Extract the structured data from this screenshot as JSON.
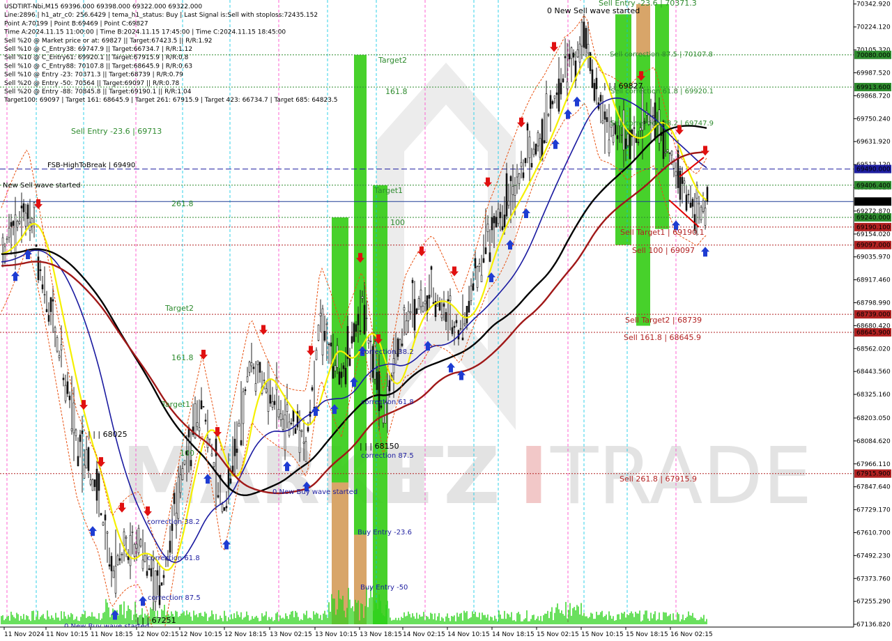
{
  "chart_data": {
    "type": "candlestick",
    "symbol": "USDTIRT-Nbi,M15",
    "info_lines": [
      "USDTIRT-Nbi,M15  69396.000 69398.000 69322.000 69322.000",
      "Line:2896 | h1_atr_c0: 256.6429 | tema_h1_status: Buy | Last Signal is:Sell with stoploss:72435.152",
      "Point A:70199 | Point B:69469 | Point C:69827",
      "Time A:2024.11.15 11:00:00 | Time B:2024.11.15 17:45:00 | Time C:2024.11.15 18:45:00",
      "Sell %20 @ Market price or at: 69827 || Target:67423.5 || R/R:1.92",
      "Sell %10 @ C_Entry38: 69747.9 || Target:66734.7 | R/R:1.12",
      "Sell %10 @ C_Entry61: 69920.1 || Target:67915.9 | R/R:0.8",
      "Sell %10 @ C_Entry88: 70107.8 || Target:68645.9 | R/R:0.63",
      "Sell %10 @ Entry -23: 70371.3 || Target:68739 | R/R:0.79",
      "Sell %20 @ Entry -50: 70564 || Target:69097 || R/R:0.78",
      "Sell %20 @ Entry -88: 70845.8 || Target:69190.1 || R/R:1.04",
      "Target100: 69097 | Target 161: 68645.9 | Target 261: 67915.9 | Target 423: 66734.7 | Target 685: 64823.5"
    ],
    "y_range": [
      67137,
      70342
    ],
    "y_ticks": [
      "70342.920",
      "70224.120",
      "70105.320",
      "69987.520",
      "69868.720",
      "69750.240",
      "69631.920",
      "69513.120",
      "69394.320",
      "69272.870",
      "69154.020",
      "69035.970",
      "68917.460",
      "68798.990",
      "68680.420",
      "68562.020",
      "68443.560",
      "68325.160",
      "68203.050",
      "68084.620",
      "67966.110",
      "67847.640",
      "67729.170",
      "67610.700",
      "67492.230",
      "67373.760",
      "67255.290",
      "67136.820"
    ],
    "x_ticks": [
      "11 Nov 2024",
      "11 Nov 10:15",
      "11 Nov 18:15",
      "12 Nov 02:15",
      "12 Nov 10:15",
      "12 Nov 18:15",
      "13 Nov 02:15",
      "13 Nov 10:15",
      "13 Nov 18:15",
      "14 Nov 02:15",
      "14 Nov 10:15",
      "14 Nov 18:15",
      "15 Nov 02:15",
      "15 Nov 10:15",
      "15 Nov 18:15",
      "16 Nov 02:15"
    ],
    "levels": [
      {
        "value": 70080,
        "label": "70080.000",
        "color": "#2e8b2e",
        "style": "dotted"
      },
      {
        "value": 69913.6,
        "label": "69913.600",
        "color": "#2e8b2e",
        "style": "dotted"
      },
      {
        "value": 69490,
        "label": "69490.000",
        "color": "#1e1ea0",
        "style": "dashed"
      },
      {
        "value": 69406.4,
        "label": "69406.400",
        "color": "#2e8b2e",
        "style": "dotted"
      },
      {
        "value": 69322,
        "label": "69322.000",
        "color": "#1e3c96",
        "style": "solid"
      },
      {
        "value": 69240,
        "label": "69240.000",
        "color": "#2e8b2e",
        "style": "dotted"
      },
      {
        "value": 69190.1,
        "label": "69190.100",
        "color": "#b22222",
        "style": "dotted"
      },
      {
        "value": 69097,
        "label": "69097.000",
        "color": "#b22222",
        "style": "dotted"
      },
      {
        "value": 68739,
        "label": "68739.000",
        "color": "#b22222",
        "style": "dotted"
      },
      {
        "value": 68645.9,
        "label": "68645.900",
        "color": "#b22222",
        "style": "dotted"
      },
      {
        "value": 67915.9,
        "label": "67915.900",
        "color": "#b22222",
        "style": "dotted"
      }
    ],
    "annotations": [
      {
        "text": "0 New Sell wave started",
        "color": "#000000"
      },
      {
        "text": "Sell Entry -23.6 | 70371.3",
        "color": "#2e8b2e"
      },
      {
        "text": "Sell correction 87.5 | 70107.8",
        "color": "#2e8b2e"
      },
      {
        "text": "| | | 69827",
        "color": "#000000"
      },
      {
        "text": "Sell correction 61.8 | 69920.1",
        "color": "#2e8b2e"
      },
      {
        "text": "Sell correction 38.2 | 69747.9",
        "color": "#2e8b2e"
      },
      {
        "text": "Sell Target1 | 69190.1",
        "color": "#b22222"
      },
      {
        "text": "Sell 100 | 69097",
        "color": "#b22222"
      },
      {
        "text": "Sell Target2 | 68739",
        "color": "#b22222"
      },
      {
        "text": "Sell 161.8 | 68645.9",
        "color": "#b22222"
      },
      {
        "text": "Sell 261.8 | 67915.9",
        "color": "#b22222"
      },
      {
        "text": "Target2",
        "color": "#2e8b2e"
      },
      {
        "text": "161.8",
        "color": "#2e8b2e"
      },
      {
        "text": "Target1",
        "color": "#2e8b2e"
      },
      {
        "text": "100",
        "color": "#2e8b2e"
      },
      {
        "text": "Sell Entry -23.6 | 69713",
        "color": "#2e8b2e"
      },
      {
        "text": "FSB-HighToBreak | 69490",
        "color": "#000000"
      },
      {
        "text": "New Sell wave started",
        "color": "#000000"
      },
      {
        "text": "261.8",
        "color": "#2e8b2e"
      },
      {
        "text": "Target2",
        "color": "#2e8b2e"
      },
      {
        "text": "161.8",
        "color": "#2e8b2e"
      },
      {
        "text": "Target1",
        "color": "#2e8b2e"
      },
      {
        "text": "100",
        "color": "#2e8b2e"
      },
      {
        "text": "| | | 68025",
        "color": "#000000"
      },
      {
        "text": "correction 38.2",
        "color": "#1e1ea0"
      },
      {
        "text": "correction 61.8",
        "color": "#1e1ea0"
      },
      {
        "text": "correction 87.5",
        "color": "#1e1ea0"
      },
      {
        "text": "| | | 67251",
        "color": "#000000"
      },
      {
        "text": "0 New Buy wave started",
        "color": "#1e1ea0"
      },
      {
        "text": "| | | 68150",
        "color": "#000000"
      },
      {
        "text": "correction 38.2",
        "color": "#1e1ea0"
      },
      {
        "text": "correction 61.8",
        "color": "#1e1ea0"
      },
      {
        "text": "correction 87.5",
        "color": "#1e1ea0"
      },
      {
        "text": "Buy Entry -23.6",
        "color": "#1e1ea0"
      },
      {
        "text": "Buy Entry -50",
        "color": "#1e1ea0"
      },
      {
        "text": "0 New Buy wave started",
        "color": "#1e1ea0"
      }
    ],
    "watermark": "MARKETZITRADE",
    "key_points": [
      {
        "x": 0,
        "y": 69050
      },
      {
        "x": 40,
        "y": 69300
      },
      {
        "x": 80,
        "y": 68600
      },
      {
        "x": 110,
        "y": 68100
      },
      {
        "x": 140,
        "y": 67800
      },
      {
        "x": 160,
        "y": 67420
      },
      {
        "x": 200,
        "y": 67550
      },
      {
        "x": 230,
        "y": 67300
      },
      {
        "x": 260,
        "y": 67900
      },
      {
        "x": 290,
        "y": 68300
      },
      {
        "x": 320,
        "y": 67700
      },
      {
        "x": 360,
        "y": 68500
      },
      {
        "x": 400,
        "y": 68250
      },
      {
        "x": 440,
        "y": 68100
      },
      {
        "x": 460,
        "y": 68700
      },
      {
        "x": 490,
        "y": 68400
      },
      {
        "x": 520,
        "y": 68800
      },
      {
        "x": 550,
        "y": 68200
      },
      {
        "x": 580,
        "y": 68700
      },
      {
        "x": 620,
        "y": 68850
      },
      {
        "x": 660,
        "y": 68650
      },
      {
        "x": 700,
        "y": 69150
      },
      {
        "x": 740,
        "y": 69400
      },
      {
        "x": 780,
        "y": 69700
      },
      {
        "x": 810,
        "y": 70000
      },
      {
        "x": 840,
        "y": 70150
      },
      {
        "x": 860,
        "y": 69800
      },
      {
        "x": 900,
        "y": 69600
      },
      {
        "x": 940,
        "y": 69800
      },
      {
        "x": 970,
        "y": 69450
      },
      {
        "x": 1000,
        "y": 69280
      },
      {
        "x": 1015,
        "y": 69322
      }
    ],
    "bands": [
      {
        "x0": 476,
        "x1": 500,
        "y_top": 69240,
        "y_bot": 67137,
        "color": "#33cc14"
      },
      {
        "x0": 508,
        "x1": 526,
        "y_top": 70080,
        "y_bot": 67137,
        "color": "#33cc14"
      },
      {
        "x0": 535,
        "x1": 556,
        "y_top": 69406.4,
        "y_bot": 67137,
        "color": "#33cc14"
      },
      {
        "x0": 476,
        "x1": 500,
        "y_top": 67870,
        "y_bot": 67137,
        "color": "#e8a070"
      },
      {
        "x0": 508,
        "x1": 526,
        "y_top": 67600,
        "y_bot": 67137,
        "color": "#e8a070"
      },
      {
        "x0": 883,
        "x1": 906,
        "y_top": 70290,
        "y_bot": 69097,
        "color": "#33cc14"
      },
      {
        "x0": 913,
        "x1": 933,
        "y_top": 70342,
        "y_bot": 68680,
        "color": "#33cc14"
      },
      {
        "x0": 940,
        "x1": 960,
        "y_top": 70342,
        "y_bot": 69180,
        "color": "#33cc14"
      },
      {
        "x0": 913,
        "x1": 933,
        "y_top": 70342,
        "y_bot": 70080,
        "color": "#e8a070"
      }
    ]
  }
}
